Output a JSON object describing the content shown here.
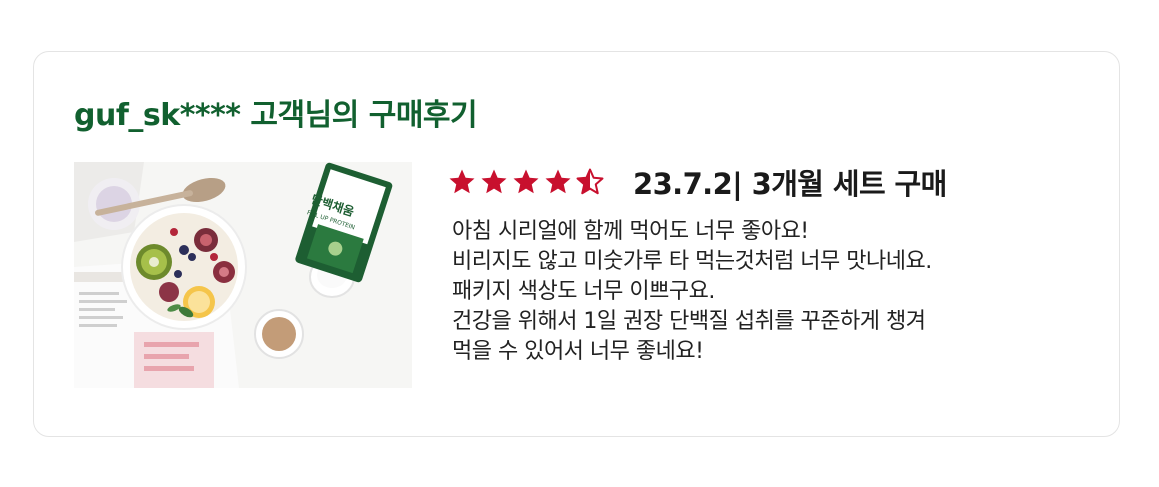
{
  "review": {
    "title": "guf_sk**** 고객님의 구매후기",
    "rating": 4.5,
    "rating_max": 5,
    "meta": "23.7.2| 3개월 세트 구매",
    "lines": [
      "아침 시리얼에 함께 먹어도 너무 좋아요!",
      "비리지도 않고 미숫가루 타 먹는것처럼 너무 맛나네요.",
      "패키지 색상도 너무 이쁘구요.",
      "건강을 위해서 1일 권장 단백질 섭취를 꾸준하게 챙겨",
      "먹을 수 있어서 너무 좋네요!"
    ],
    "photo": {
      "package_text": "단백채움",
      "package_subtext": "FILL UP PROTEIN"
    }
  },
  "colors": {
    "title_green": "#11602f",
    "star_red": "#c8102e",
    "text": "#222222",
    "border": "#e4e4e4"
  },
  "icons": {
    "star": "star-icon",
    "half_star": "half-star-icon"
  }
}
